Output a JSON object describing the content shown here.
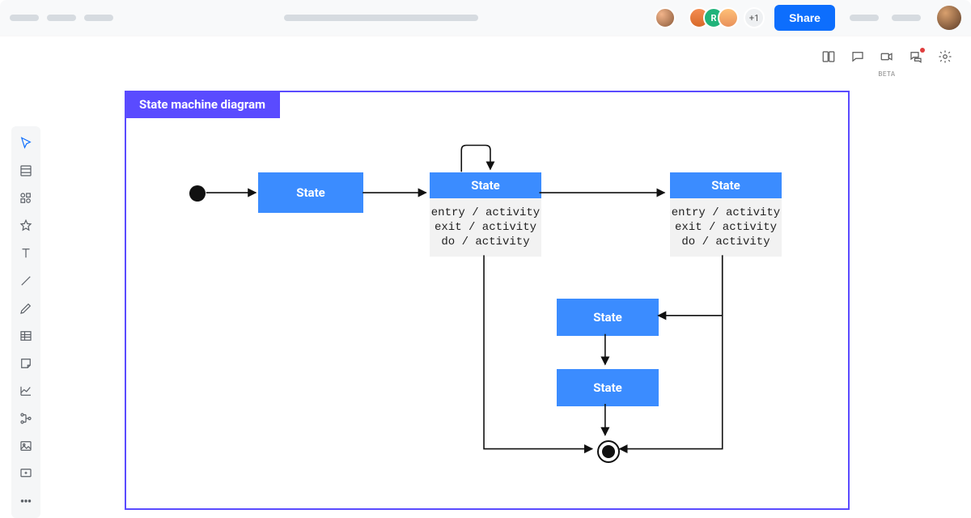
{
  "topbar": {
    "plus_count": "+1",
    "share_label": "Share"
  },
  "subtoolbar": {
    "beta_label": "BETA"
  },
  "frame": {
    "title": "State machine diagram"
  },
  "states": {
    "s1": "State",
    "s2": "State",
    "s3": "State",
    "s4": "State",
    "s5": "State"
  },
  "activities": {
    "entry": "entry / activity",
    "exit": "exit / activity",
    "do": "do / activity"
  }
}
